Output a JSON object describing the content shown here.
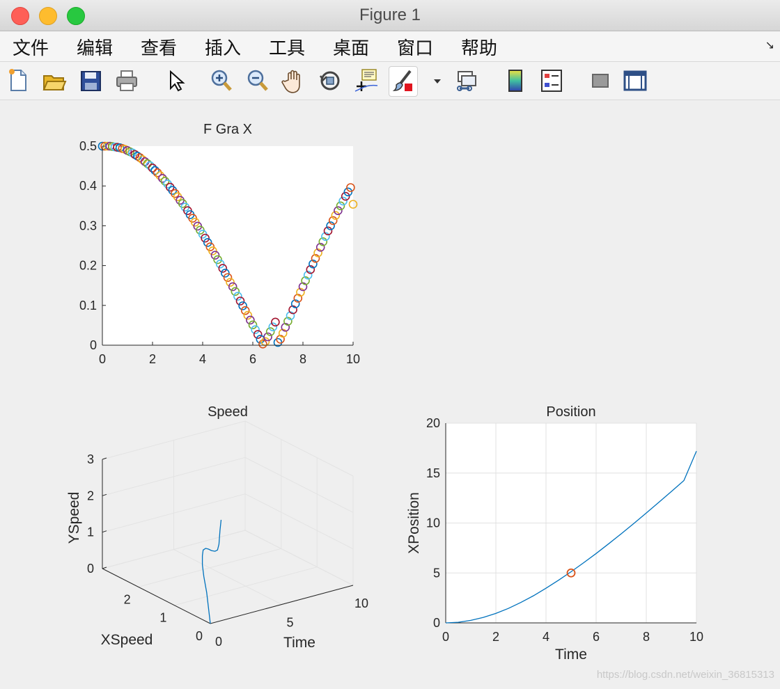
{
  "window": {
    "title": "Figure 1"
  },
  "menu": [
    "文件",
    "编辑",
    "查看",
    "插入",
    "工具",
    "桌面",
    "窗口",
    "帮助"
  ],
  "toolbar": [
    "new-figure-icon",
    "open-file-icon",
    "save-icon",
    "print-icon",
    "pointer-icon",
    "zoom-in-icon",
    "zoom-out-icon",
    "pan-icon",
    "rotate-3d-icon",
    "data-cursor-icon",
    "brush-icon",
    "link-plots-icon",
    "colorbar-icon",
    "legend-icon",
    "hide-plot-tools-icon",
    "show-plot-tools-icon"
  ],
  "colors": {
    "axes_bg": "#ffffff",
    "line": "#0072bd",
    "marker_red": "#d95319",
    "marker_cycle": [
      "#0072bd",
      "#d95319",
      "#edb120",
      "#7e2f8e",
      "#77ac30",
      "#4dbeee",
      "#a2142f"
    ]
  },
  "watermark": "https://blog.csdn.net/weixin_36815313",
  "chart_data": [
    {
      "type": "scatter",
      "title": "F Gra X",
      "xlabel": "",
      "ylabel": "",
      "xlim": [
        0,
        10
      ],
      "ylim": [
        0,
        0.5
      ],
      "xticks": [
        "0",
        "2",
        "4",
        "6",
        "8",
        "10"
      ],
      "yticks": [
        "0",
        "0.1",
        "0.2",
        "0.3",
        "0.4",
        "0.5"
      ],
      "grid": false,
      "marker": "circle-open",
      "points": [
        [
          0,
          0.5
        ],
        [
          0.1,
          0.5
        ],
        [
          0.2,
          0.5
        ],
        [
          0.3,
          0.5
        ],
        [
          0.4,
          0.499
        ],
        [
          0.5,
          0.498
        ],
        [
          0.6,
          0.497
        ],
        [
          0.7,
          0.496
        ],
        [
          0.8,
          0.494
        ],
        [
          0.9,
          0.492
        ],
        [
          1.0,
          0.489
        ],
        [
          1.1,
          0.486
        ],
        [
          1.2,
          0.483
        ],
        [
          1.3,
          0.479
        ],
        [
          1.4,
          0.475
        ],
        [
          1.5,
          0.471
        ],
        [
          1.6,
          0.466
        ],
        [
          1.7,
          0.461
        ],
        [
          1.8,
          0.456
        ],
        [
          1.9,
          0.451
        ],
        [
          2.0,
          0.445
        ],
        [
          2.1,
          0.439
        ],
        [
          2.2,
          0.433
        ],
        [
          2.3,
          0.426
        ],
        [
          2.4,
          0.419
        ],
        [
          2.5,
          0.412
        ],
        [
          2.6,
          0.405
        ],
        [
          2.7,
          0.397
        ],
        [
          2.8,
          0.389
        ],
        [
          2.9,
          0.381
        ],
        [
          3.0,
          0.373
        ],
        [
          3.1,
          0.364
        ],
        [
          3.2,
          0.356
        ],
        [
          3.3,
          0.347
        ],
        [
          3.4,
          0.338
        ],
        [
          3.5,
          0.328
        ],
        [
          3.6,
          0.319
        ],
        [
          3.7,
          0.309
        ],
        [
          3.8,
          0.299
        ],
        [
          3.9,
          0.289
        ],
        [
          4.0,
          0.279
        ],
        [
          4.1,
          0.269
        ],
        [
          4.2,
          0.258
        ],
        [
          4.3,
          0.247
        ],
        [
          4.4,
          0.237
        ],
        [
          4.5,
          0.226
        ],
        [
          4.6,
          0.215
        ],
        [
          4.7,
          0.204
        ],
        [
          4.8,
          0.193
        ],
        [
          4.9,
          0.181
        ],
        [
          5.0,
          0.17
        ],
        [
          5.1,
          0.158
        ],
        [
          5.2,
          0.147
        ],
        [
          5.3,
          0.135
        ],
        [
          5.4,
          0.123
        ],
        [
          5.5,
          0.111
        ],
        [
          5.6,
          0.099
        ],
        [
          5.7,
          0.087
        ],
        [
          5.8,
          0.075
        ],
        [
          5.9,
          0.063
        ],
        [
          6.0,
          0.051
        ],
        [
          6.1,
          0.039
        ],
        [
          6.2,
          0.027
        ],
        [
          6.3,
          0.015
        ],
        [
          6.4,
          0.003
        ],
        [
          6.5,
          0.009
        ],
        [
          6.6,
          0.021
        ],
        [
          6.7,
          0.034
        ],
        [
          6.8,
          0.046
        ],
        [
          6.9,
          0.058
        ],
        [
          7.0,
          0.007
        ],
        [
          7.1,
          0.015
        ],
        [
          7.2,
          0.03
        ],
        [
          7.3,
          0.045
        ],
        [
          7.4,
          0.06
        ],
        [
          7.5,
          0.074
        ],
        [
          7.6,
          0.089
        ],
        [
          7.7,
          0.104
        ],
        [
          7.8,
          0.118
        ],
        [
          7.9,
          0.133
        ],
        [
          8.0,
          0.147
        ],
        [
          8.1,
          0.162
        ],
        [
          8.2,
          0.176
        ],
        [
          8.3,
          0.19
        ],
        [
          8.4,
          0.204
        ],
        [
          8.5,
          0.218
        ],
        [
          8.6,
          0.232
        ],
        [
          8.7,
          0.246
        ],
        [
          8.8,
          0.26
        ],
        [
          8.9,
          0.273
        ],
        [
          9.0,
          0.287
        ],
        [
          9.1,
          0.3
        ],
        [
          9.2,
          0.313
        ],
        [
          9.3,
          0.326
        ],
        [
          9.4,
          0.338
        ],
        [
          9.5,
          0.35
        ],
        [
          9.6,
          0.362
        ],
        [
          9.7,
          0.374
        ],
        [
          9.8,
          0.385
        ],
        [
          9.9,
          0.396
        ],
        [
          10.0,
          0.354
        ]
      ]
    },
    {
      "type": "line",
      "title": "Speed",
      "projection": "3d",
      "xlabel": "Time",
      "ylabel": "XSpeed",
      "zlabel": "YSpeed",
      "xlim": [
        0,
        10
      ],
      "ylim": [
        0,
        3
      ],
      "zlim": [
        0,
        3
      ],
      "xticks": [
        "0",
        "5",
        "10"
      ],
      "yticks": [
        "0",
        "1",
        "2"
      ],
      "zticks": [
        "0",
        "1",
        "2",
        "3"
      ],
      "grid": true,
      "points": [
        [
          0,
          0,
          0
        ],
        [
          0,
          0.05,
          0.4
        ],
        [
          0,
          0.1,
          0.8
        ],
        [
          0,
          0.18,
          1.2
        ],
        [
          0,
          0.22,
          1.5
        ],
        [
          0,
          0.22,
          1.75
        ],
        [
          0,
          0.2,
          1.92
        ],
        [
          0,
          0.13,
          2.0
        ],
        [
          0,
          0.05,
          2.02
        ],
        [
          0,
          -0.03,
          2.02
        ],
        [
          0,
          -0.13,
          2.05
        ],
        [
          0,
          -0.2,
          2.12
        ],
        [
          0,
          -0.24,
          2.3
        ],
        [
          0,
          -0.27,
          2.7
        ],
        [
          0,
          -0.3,
          3.0
        ]
      ]
    },
    {
      "type": "line",
      "title": "Position",
      "xlabel": "Time",
      "ylabel": "XPosition",
      "xlim": [
        0,
        10
      ],
      "ylim": [
        0,
        20
      ],
      "xticks": [
        "0",
        "2",
        "4",
        "6",
        "8",
        "10"
      ],
      "yticks": [
        "0",
        "5",
        "10",
        "15",
        "20"
      ],
      "grid": true,
      "series": [
        {
          "points": [
            [
              0,
              0
            ],
            [
              0.5,
              0.06
            ],
            [
              1,
              0.25
            ],
            [
              1.5,
              0.55
            ],
            [
              2,
              0.95
            ],
            [
              2.5,
              1.45
            ],
            [
              3,
              2.05
            ],
            [
              3.5,
              2.72
            ],
            [
              4,
              3.47
            ],
            [
              4.5,
              4.27
            ],
            [
              5,
              5.12
            ],
            [
              5.5,
              6.02
            ],
            [
              6,
              6.95
            ],
            [
              6.5,
              7.92
            ],
            [
              7,
              8.92
            ],
            [
              7.5,
              9.95
            ],
            [
              8,
              11.0
            ],
            [
              8.5,
              12.07
            ],
            [
              9,
              13.15
            ],
            [
              9.5,
              14.25
            ],
            [
              10,
              17.2
            ]
          ]
        }
      ],
      "markers": [
        [
          5,
          5
        ]
      ]
    }
  ]
}
